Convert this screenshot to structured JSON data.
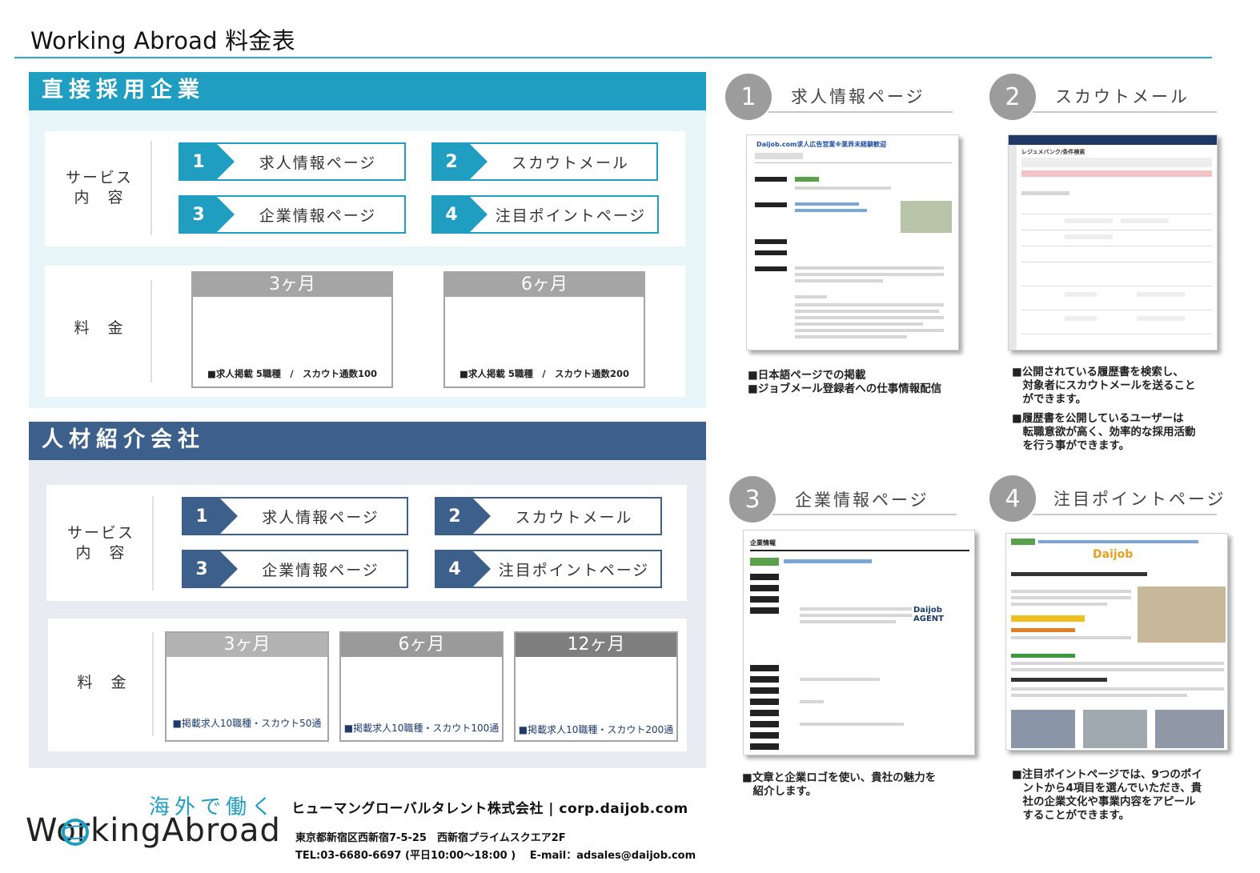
{
  "page": {
    "title": "Working Abroad 料金表"
  },
  "direct": {
    "header": "直接採用企業",
    "service_label_1": "サービス",
    "service_label_2": "内　容",
    "services": [
      {
        "num": "1",
        "label": "求人情報ページ"
      },
      {
        "num": "2",
        "label": "スカウトメール"
      },
      {
        "num": "3",
        "label": "企業情報ページ"
      },
      {
        "num": "4",
        "label": "注目ポイントページ"
      }
    ],
    "price_label": "料　金",
    "plans": [
      {
        "title": "3ヶ月",
        "note": "■求人掲載 5職種　/　スカウト通数100"
      },
      {
        "title": "6ヶ月",
        "note": "■求人掲載 5職種　/　スカウト通数200"
      }
    ]
  },
  "agency": {
    "header": "人材紹介会社",
    "service_label_1": "サービス",
    "service_label_2": "内　容",
    "services": [
      {
        "num": "1",
        "label": "求人情報ページ"
      },
      {
        "num": "2",
        "label": "スカウトメール"
      },
      {
        "num": "3",
        "label": "企業情報ページ"
      },
      {
        "num": "4",
        "label": "注目ポイントページ"
      }
    ],
    "price_label": "料　金",
    "plans": [
      {
        "title": "3ヶ月",
        "note": "■掲載求人10職種・スカウト50通"
      },
      {
        "title": "6ヶ月",
        "note": "■掲載求人10職種・スカウト100通"
      },
      {
        "title": "12ヶ月",
        "note": "■掲載求人10職種・スカウト200通"
      }
    ]
  },
  "features": [
    {
      "num": "1",
      "title": "求人情報ページ",
      "shot_header": "Daijob.com求人広告営業※業界未経験歓迎",
      "desc": [
        "■日本語ページでの掲載",
        "■ジョブメール登録者への仕事情報配信"
      ]
    },
    {
      "num": "2",
      "title": "スカウトメール",
      "shot_header": "レジュメバンク/条件検索",
      "desc": [
        "■公開されている履歴書を検索し、",
        "　対象者にスカウトメールを送ること",
        "　ができます。",
        "■履歴書を公開しているユーザーは",
        "　転職意欲が高く、効率的な採用活動",
        "　を行う事ができます。"
      ]
    },
    {
      "num": "3",
      "title": "企業情報ページ",
      "shot_header": "企業情報",
      "shot_logo": "Daijob AGENT",
      "desc": [
        "■文章と企業ロゴを使い、貴社の魅力を",
        "　紹介します。"
      ]
    },
    {
      "num": "4",
      "title": "注目ポイントページ",
      "shot_header": "Daijob",
      "desc": [
        "■注目ポイントページでは、9つのポイ",
        "　ントから4項目を選んでいただき、貴",
        "　社の企業文化や事業内容をアピール",
        "　することができます。"
      ]
    }
  ],
  "footer": {
    "tagline": "海外で働く",
    "logo": "WorkingAbroad",
    "company": "ヒューマングローバルタレント株式会社 | corp.daijob.com",
    "address": "東京都新宿区西新宿7-5-25　西新宿プライムスクエア2F",
    "contact": "TEL:03-6680-6697 (平日10:00～18:00 )　 E-mail：adsales@daijob.com"
  },
  "colors": {
    "teal": "#1f9ec1",
    "navy": "#3c5f8c",
    "gray": "#9c9c9c"
  }
}
